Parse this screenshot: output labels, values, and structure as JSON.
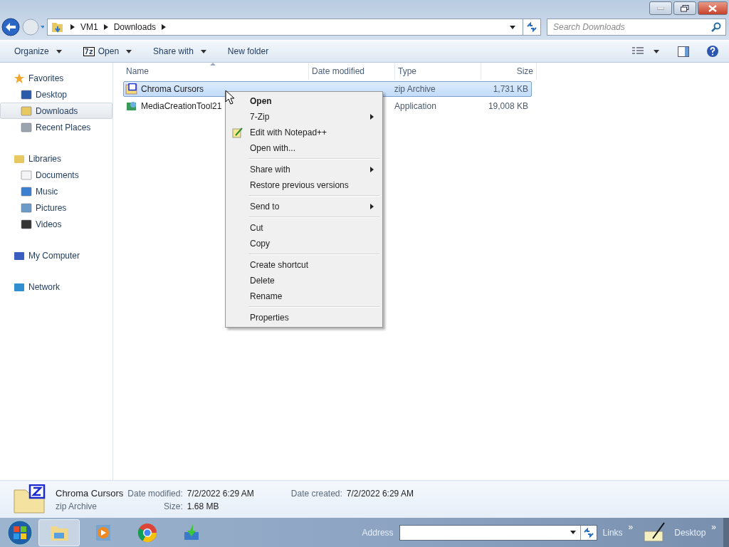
{
  "address": {
    "crumbs": [
      "VM1",
      "Downloads"
    ]
  },
  "search": {
    "placeholder": "Search Downloads"
  },
  "toolbar": [
    {
      "label": "Organize",
      "dropdown": true
    },
    {
      "label": "Open",
      "badge": "7z",
      "dropdown": true
    },
    {
      "label": "Share with",
      "dropdown": true
    },
    {
      "label": "New folder",
      "dropdown": false
    }
  ],
  "sidebar": [
    {
      "label": "Favorites",
      "kind": "favorites",
      "selected": false,
      "children": [
        {
          "label": "Desktop",
          "kind": "desktop",
          "selected": false
        },
        {
          "label": "Downloads",
          "kind": "downloads",
          "selected": true
        },
        {
          "label": "Recent Places",
          "kind": "recent",
          "selected": false
        }
      ]
    },
    {
      "label": "Libraries",
      "kind": "libraries",
      "selected": false,
      "children": [
        {
          "label": "Documents",
          "kind": "documents",
          "selected": false
        },
        {
          "label": "Music",
          "kind": "music",
          "selected": false
        },
        {
          "label": "Pictures",
          "kind": "pictures",
          "selected": false
        },
        {
          "label": "Videos",
          "kind": "videos",
          "selected": false
        }
      ]
    },
    {
      "label": "My Computer",
      "kind": "computer",
      "selected": false
    },
    {
      "label": "Network",
      "kind": "network",
      "selected": false
    }
  ],
  "table": {
    "columns": [
      {
        "label": "Name",
        "sorted": true
      },
      {
        "label": "Date modified",
        "sorted": false
      },
      {
        "label": "Type",
        "sorted": false
      },
      {
        "label": "Size",
        "sorted": false
      }
    ],
    "rows": [
      {
        "name": "Chroma Cursors",
        "kind": "zip",
        "type": "zip Archive",
        "size": "1,731 KB",
        "selected": true
      },
      {
        "name": "MediaCreationTool21",
        "kind": "app",
        "type": "Application",
        "size": "19,008 KB",
        "selected": false
      }
    ]
  },
  "context_menu": [
    {
      "kind": "item",
      "label": "Open",
      "default": true,
      "submenu": false,
      "icon": false
    },
    {
      "kind": "item",
      "label": "7-Zip",
      "default": false,
      "submenu": true,
      "icon": false
    },
    {
      "kind": "item",
      "label": "Edit with Notepad++",
      "default": false,
      "submenu": false,
      "icon": true
    },
    {
      "kind": "item",
      "label": "Open with...",
      "default": false,
      "submenu": false,
      "icon": false
    },
    {
      "kind": "separator"
    },
    {
      "kind": "item",
      "label": "Share with",
      "default": false,
      "submenu": true,
      "icon": false
    },
    {
      "kind": "item",
      "label": "Restore previous versions",
      "default": false,
      "submenu": false,
      "icon": false
    },
    {
      "kind": "separator"
    },
    {
      "kind": "item",
      "label": "Send to",
      "default": false,
      "submenu": true,
      "icon": false
    },
    {
      "kind": "separator"
    },
    {
      "kind": "item",
      "label": "Cut",
      "default": false,
      "submenu": false,
      "icon": false
    },
    {
      "kind": "item",
      "label": "Copy",
      "default": false,
      "submenu": false,
      "icon": false
    },
    {
      "kind": "separator"
    },
    {
      "kind": "item",
      "label": "Create shortcut",
      "default": false,
      "submenu": false,
      "icon": false
    },
    {
      "kind": "item",
      "label": "Delete",
      "default": false,
      "submenu": false,
      "icon": false
    },
    {
      "kind": "item",
      "label": "Rename",
      "default": false,
      "submenu": false,
      "icon": false
    },
    {
      "kind": "separator"
    },
    {
      "kind": "item",
      "label": "Properties",
      "default": false,
      "submenu": false,
      "icon": false
    }
  ],
  "details": {
    "name": "Chroma Cursors",
    "type": "zip Archive",
    "fields": [
      {
        "label": "Date modified:",
        "value": "7/2/2022 6:29 AM"
      },
      {
        "label": "Size:",
        "value": "1.68 MB"
      },
      {
        "label": "Date created:",
        "value": "7/2/2022 6:29 AM"
      }
    ]
  },
  "taskbar": {
    "apps": [
      {
        "kind": "explorer",
        "selected": true
      },
      {
        "kind": "media",
        "selected": false
      },
      {
        "kind": "chrome",
        "selected": false
      },
      {
        "kind": "installer",
        "selected": false
      }
    ],
    "address_label": "Address",
    "links_label": "Links",
    "links_more": "»",
    "desktop_label": "Desktop",
    "desktop_more": "»"
  }
}
